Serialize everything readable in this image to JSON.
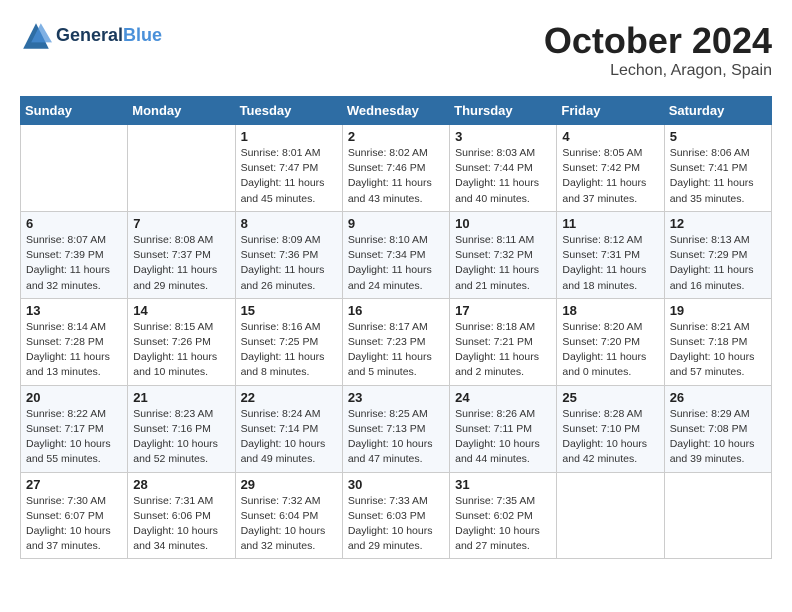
{
  "header": {
    "logo_line1": "General",
    "logo_line2": "Blue",
    "month_title": "October 2024",
    "location": "Lechon, Aragon, Spain"
  },
  "days_of_week": [
    "Sunday",
    "Monday",
    "Tuesday",
    "Wednesday",
    "Thursday",
    "Friday",
    "Saturday"
  ],
  "weeks": [
    [
      {
        "num": "",
        "info": ""
      },
      {
        "num": "",
        "info": ""
      },
      {
        "num": "1",
        "info": "Sunrise: 8:01 AM\nSunset: 7:47 PM\nDaylight: 11 hours and 45 minutes."
      },
      {
        "num": "2",
        "info": "Sunrise: 8:02 AM\nSunset: 7:46 PM\nDaylight: 11 hours and 43 minutes."
      },
      {
        "num": "3",
        "info": "Sunrise: 8:03 AM\nSunset: 7:44 PM\nDaylight: 11 hours and 40 minutes."
      },
      {
        "num": "4",
        "info": "Sunrise: 8:05 AM\nSunset: 7:42 PM\nDaylight: 11 hours and 37 minutes."
      },
      {
        "num": "5",
        "info": "Sunrise: 8:06 AM\nSunset: 7:41 PM\nDaylight: 11 hours and 35 minutes."
      }
    ],
    [
      {
        "num": "6",
        "info": "Sunrise: 8:07 AM\nSunset: 7:39 PM\nDaylight: 11 hours and 32 minutes."
      },
      {
        "num": "7",
        "info": "Sunrise: 8:08 AM\nSunset: 7:37 PM\nDaylight: 11 hours and 29 minutes."
      },
      {
        "num": "8",
        "info": "Sunrise: 8:09 AM\nSunset: 7:36 PM\nDaylight: 11 hours and 26 minutes."
      },
      {
        "num": "9",
        "info": "Sunrise: 8:10 AM\nSunset: 7:34 PM\nDaylight: 11 hours and 24 minutes."
      },
      {
        "num": "10",
        "info": "Sunrise: 8:11 AM\nSunset: 7:32 PM\nDaylight: 11 hours and 21 minutes."
      },
      {
        "num": "11",
        "info": "Sunrise: 8:12 AM\nSunset: 7:31 PM\nDaylight: 11 hours and 18 minutes."
      },
      {
        "num": "12",
        "info": "Sunrise: 8:13 AM\nSunset: 7:29 PM\nDaylight: 11 hours and 16 minutes."
      }
    ],
    [
      {
        "num": "13",
        "info": "Sunrise: 8:14 AM\nSunset: 7:28 PM\nDaylight: 11 hours and 13 minutes."
      },
      {
        "num": "14",
        "info": "Sunrise: 8:15 AM\nSunset: 7:26 PM\nDaylight: 11 hours and 10 minutes."
      },
      {
        "num": "15",
        "info": "Sunrise: 8:16 AM\nSunset: 7:25 PM\nDaylight: 11 hours and 8 minutes."
      },
      {
        "num": "16",
        "info": "Sunrise: 8:17 AM\nSunset: 7:23 PM\nDaylight: 11 hours and 5 minutes."
      },
      {
        "num": "17",
        "info": "Sunrise: 8:18 AM\nSunset: 7:21 PM\nDaylight: 11 hours and 2 minutes."
      },
      {
        "num": "18",
        "info": "Sunrise: 8:20 AM\nSunset: 7:20 PM\nDaylight: 11 hours and 0 minutes."
      },
      {
        "num": "19",
        "info": "Sunrise: 8:21 AM\nSunset: 7:18 PM\nDaylight: 10 hours and 57 minutes."
      }
    ],
    [
      {
        "num": "20",
        "info": "Sunrise: 8:22 AM\nSunset: 7:17 PM\nDaylight: 10 hours and 55 minutes."
      },
      {
        "num": "21",
        "info": "Sunrise: 8:23 AM\nSunset: 7:16 PM\nDaylight: 10 hours and 52 minutes."
      },
      {
        "num": "22",
        "info": "Sunrise: 8:24 AM\nSunset: 7:14 PM\nDaylight: 10 hours and 49 minutes."
      },
      {
        "num": "23",
        "info": "Sunrise: 8:25 AM\nSunset: 7:13 PM\nDaylight: 10 hours and 47 minutes."
      },
      {
        "num": "24",
        "info": "Sunrise: 8:26 AM\nSunset: 7:11 PM\nDaylight: 10 hours and 44 minutes."
      },
      {
        "num": "25",
        "info": "Sunrise: 8:28 AM\nSunset: 7:10 PM\nDaylight: 10 hours and 42 minutes."
      },
      {
        "num": "26",
        "info": "Sunrise: 8:29 AM\nSunset: 7:08 PM\nDaylight: 10 hours and 39 minutes."
      }
    ],
    [
      {
        "num": "27",
        "info": "Sunrise: 7:30 AM\nSunset: 6:07 PM\nDaylight: 10 hours and 37 minutes."
      },
      {
        "num": "28",
        "info": "Sunrise: 7:31 AM\nSunset: 6:06 PM\nDaylight: 10 hours and 34 minutes."
      },
      {
        "num": "29",
        "info": "Sunrise: 7:32 AM\nSunset: 6:04 PM\nDaylight: 10 hours and 32 minutes."
      },
      {
        "num": "30",
        "info": "Sunrise: 7:33 AM\nSunset: 6:03 PM\nDaylight: 10 hours and 29 minutes."
      },
      {
        "num": "31",
        "info": "Sunrise: 7:35 AM\nSunset: 6:02 PM\nDaylight: 10 hours and 27 minutes."
      },
      {
        "num": "",
        "info": ""
      },
      {
        "num": "",
        "info": ""
      }
    ]
  ]
}
